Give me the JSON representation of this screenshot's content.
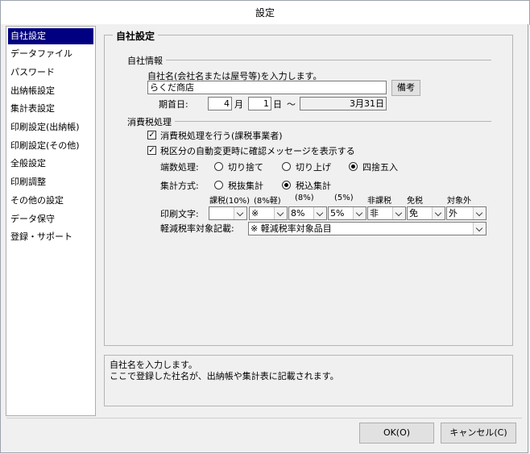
{
  "window": {
    "title": "設定"
  },
  "sidebar": {
    "items": [
      {
        "label": "自社設定",
        "selected": true
      },
      {
        "label": "データファイル"
      },
      {
        "label": "パスワード"
      },
      {
        "label": "出納帳設定"
      },
      {
        "label": "集計表設定"
      },
      {
        "label": "印刷設定(出納帳)"
      },
      {
        "label": "印刷設定(その他)"
      },
      {
        "label": "全般設定"
      },
      {
        "label": "印刷調整"
      },
      {
        "label": "その他の設定"
      },
      {
        "label": "データ保守"
      },
      {
        "label": "登録・サポート"
      }
    ]
  },
  "panel": {
    "title": "自社設定",
    "company": {
      "group_label": "自社情報",
      "name_prompt": "自社名(会社名または屋号等)を入力します。",
      "name_value": "らくだ商店",
      "memo_button": "備考",
      "fiscal_label": "期首日:",
      "month_value": "4",
      "month_unit": "月",
      "day_value": "1",
      "day_unit": "日",
      "tilde": "～",
      "end_value": "3月31日"
    },
    "tax": {
      "group_label": "消費税処理",
      "chk1_label": "消費税処理を行う(課税事業者)",
      "chk1_checked": true,
      "chk2_label": "税区分の自動変更時に確認メッセージを表示する",
      "chk2_checked": true,
      "rounding_label": "端数処理:",
      "rounding_options": [
        "切り捨て",
        "切り上げ",
        "四捨五入"
      ],
      "rounding_selected": 2,
      "method_label": "集計方式:",
      "method_options": [
        "税抜集計",
        "税込集計"
      ],
      "method_selected": 1,
      "print_label": "印刷文字:",
      "print_columns": [
        {
          "header": "課税(10%)",
          "value": ""
        },
        {
          "header": "(8%軽)",
          "value": "※"
        },
        {
          "header": "(8%)",
          "value": "8%"
        },
        {
          "header": "(5%)",
          "value": "5%"
        },
        {
          "header": "非課税",
          "value": "非"
        },
        {
          "header": "免税",
          "value": "免"
        },
        {
          "header": "対象外",
          "value": "外"
        }
      ],
      "reduced_label": "軽減税率対象記載:",
      "reduced_value": "※ 軽減税率対象品目"
    }
  },
  "description": {
    "line1": "自社名を入力します。",
    "line2": "ここで登録した社名が、出納帳や集計表に記載されます。"
  },
  "buttons": {
    "ok": "OK(O)",
    "cancel": "キャンセル(C)"
  }
}
